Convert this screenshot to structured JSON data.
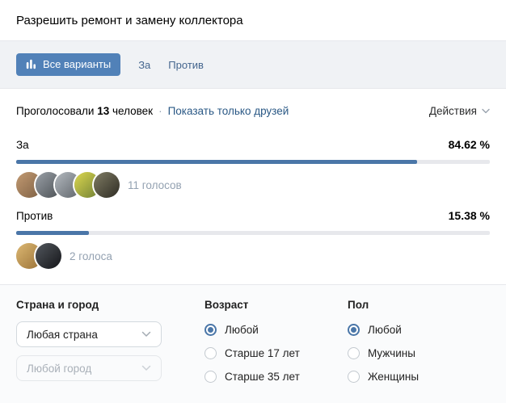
{
  "title": "Разрешить ремонт и замену коллектора",
  "tabs": {
    "all_label": "Все варианты",
    "for_label": "За",
    "against_label": "Против"
  },
  "summary": {
    "voted_prefix": "Проголосовали",
    "voted_count": "13",
    "voted_suffix": "человек",
    "separator": "·",
    "friends_link": "Показать только друзей",
    "actions_label": "Действия"
  },
  "options": [
    {
      "label": "За",
      "percent_label": "84.62 %",
      "percent_width": "84.62%",
      "votes_label": "11 голосов",
      "avatars": [
        {
          "bg": "linear-gradient(135deg,#c29a72,#7e6044)"
        },
        {
          "bg": "linear-gradient(135deg,#9aa0a7,#4b5054)"
        },
        {
          "bg": "linear-gradient(135deg,#b3b9bf,#5f646a)"
        },
        {
          "bg": "linear-gradient(135deg,#ddd84f,#6f7f35)"
        },
        {
          "bg": "linear-gradient(135deg,#807c64,#2e2c24)"
        }
      ]
    },
    {
      "label": "Против",
      "percent_label": "15.38 %",
      "percent_width": "15.38%",
      "votes_label": "2 голоса",
      "avatars": [
        {
          "bg": "linear-gradient(135deg,#dcb873,#9a7136)"
        },
        {
          "bg": "linear-gradient(135deg,#53575e,#141619)"
        }
      ]
    }
  ],
  "filters": {
    "location": {
      "header": "Страна и город",
      "country_value": "Любая страна",
      "city_value": "Любой город"
    },
    "age": {
      "header": "Возраст",
      "options": [
        {
          "label": "Любой",
          "selected": true
        },
        {
          "label": "Старше 17 лет",
          "selected": false
        },
        {
          "label": "Старше 35 лет",
          "selected": false
        }
      ]
    },
    "gender": {
      "header": "Пол",
      "options": [
        {
          "label": "Любой",
          "selected": true
        },
        {
          "label": "Мужчины",
          "selected": false
        },
        {
          "label": "Женщины",
          "selected": false
        }
      ]
    }
  },
  "colors": {
    "accent_blue": "#5181b8",
    "bar_fill": "#4a76a8",
    "bar_track": "#e7e8ec",
    "link_blue": "#2a5885",
    "tab_link": "#45668e",
    "muted_text": "#93a1b1",
    "panel_bg": "#fafbfc",
    "tabbar_bg": "#f0f2f5",
    "border": "#e7e8ec"
  }
}
